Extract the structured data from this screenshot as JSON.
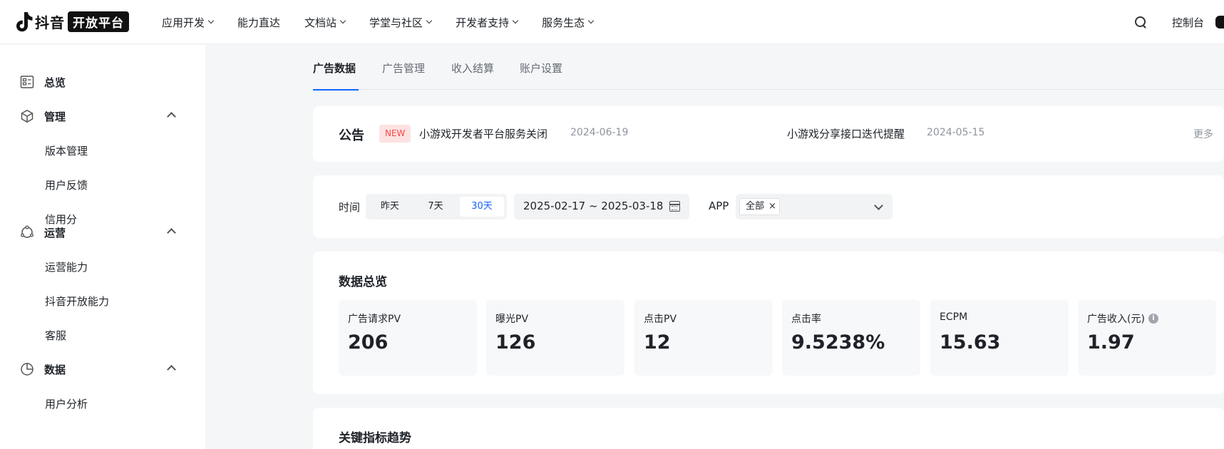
{
  "brand": {
    "name": "抖音",
    "badge": "开放平台"
  },
  "nav": [
    {
      "label": "应用开发",
      "dropdown": true
    },
    {
      "label": "能力直达",
      "dropdown": false
    },
    {
      "label": "文档站",
      "dropdown": true
    },
    {
      "label": "学堂与社区",
      "dropdown": true
    },
    {
      "label": "开发者支持",
      "dropdown": true
    },
    {
      "label": "服务生态",
      "dropdown": true
    }
  ],
  "topright": {
    "console": "控制台"
  },
  "sidebar": {
    "overview": "总览",
    "groups": [
      {
        "label": "管理",
        "icon": "cube-icon",
        "items": [
          "版本管理",
          "用户反馈",
          "信用分"
        ]
      },
      {
        "label": "运营",
        "icon": "operation-icon",
        "items": [
          "运营能力",
          "抖音开放能力",
          "客服"
        ]
      },
      {
        "label": "数据",
        "icon": "pie-chart-icon",
        "items": [
          "用户分析"
        ]
      }
    ]
  },
  "tabs": [
    "广告数据",
    "广告管理",
    "收入结算",
    "账户设置"
  ],
  "notice": {
    "title": "公告",
    "badge": "NEW",
    "items": [
      {
        "text": "小游戏开发者平台服务关闭",
        "date": "2024-06-19"
      },
      {
        "text": "小游戏分享接口迭代提醒",
        "date": "2024-05-15"
      }
    ],
    "more": "更多"
  },
  "filter": {
    "time_label": "时间",
    "segments": [
      "昨天",
      "7天",
      "30天"
    ],
    "active_segment": "30天",
    "date_range": "2025-02-17 ~ 2025-03-18",
    "app_label": "APP",
    "app_tag": "全部",
    "tag_close": "×"
  },
  "overview": {
    "title": "数据总览",
    "metrics": [
      {
        "label": "广告请求PV",
        "value": "206"
      },
      {
        "label": "曝光PV",
        "value": "126"
      },
      {
        "label": "点击PV",
        "value": "12"
      },
      {
        "label": "点击率",
        "value": "9.5238%"
      },
      {
        "label": "ECPM",
        "value": "15.63"
      },
      {
        "label": "广告收入(元)",
        "value": "1.97",
        "info": true
      }
    ]
  },
  "trend": {
    "title": "关键指标趋势"
  },
  "colors": {
    "accent": "#1664ff",
    "new_badge_bg": "#fde2e2",
    "new_badge_text": "#f54a45"
  }
}
